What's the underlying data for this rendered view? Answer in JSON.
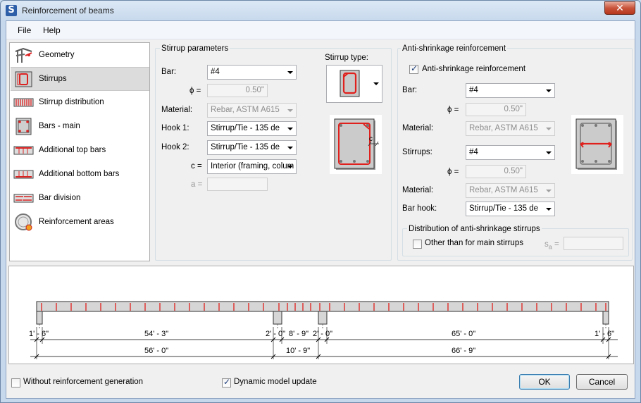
{
  "window": {
    "title": "Reinforcement of beams",
    "app_icon": "S",
    "close_glyph": "✕"
  },
  "menu": [
    "File",
    "Help"
  ],
  "sidebar": {
    "items": [
      {
        "label": "Geometry",
        "icon": "geometry-icon"
      },
      {
        "label": "Stirrups",
        "icon": "stirrups-icon"
      },
      {
        "label": "Stirrup distribution",
        "icon": "stirrup-distribution-icon"
      },
      {
        "label": "Bars - main",
        "icon": "main-bars-icon"
      },
      {
        "label": "Additional top bars",
        "icon": "top-bars-icon"
      },
      {
        "label": "Additional bottom bars",
        "icon": "bottom-bars-icon"
      },
      {
        "label": "Bar division",
        "icon": "bar-division-icon"
      },
      {
        "label": "Reinforcement areas",
        "icon": "reinforcement-areas-icon"
      }
    ],
    "selected": "Stirrups"
  },
  "stirrup_params": {
    "title": "Stirrup parameters",
    "bar_label": "Bar:",
    "bar_value": "#4",
    "phi_label": "ϕ =",
    "phi_value": "0.50\"",
    "material_label": "Material:",
    "material_value": "Rebar, ASTM A615",
    "hook1_label": "Hook 1:",
    "hook1_value": "Stirrup/Tie - 135 de",
    "hook2_label": "Hook 2:",
    "hook2_value": "Stirrup/Tie - 135 de",
    "c_label": "c =",
    "c_value": "Interior (framing, colum",
    "a_label": "a =",
    "a_value": "",
    "stirrup_type_label": "Stirrup type:",
    "preview_c_label": "c"
  },
  "anti_shrinkage": {
    "title": "Anti-shrinkage reinforcement",
    "checkbox_label": "Anti-shrinkage reinforcement",
    "checked": true,
    "bar_label": "Bar:",
    "bar_value": "#4",
    "phi1_label": "ϕ =",
    "phi1_value": "0.50\"",
    "material1_label": "Material:",
    "material1_value": "Rebar, ASTM A615",
    "stirrups_label": "Stirrups:",
    "stirrups_value": "#4",
    "phi2_label": "ϕ =",
    "phi2_value": "0.50\"",
    "material2_label": "Material:",
    "material2_value": "Rebar, ASTM A615",
    "hook_label": "Bar hook:",
    "hook_value": "Stirrup/Tie - 135 de",
    "distribution": {
      "title": "Distribution of anti-shrinkage stirrups",
      "checkbox_label": "Other than for main stirrups",
      "checked": false,
      "sa_label": "s",
      "sa_sub": "a",
      "sa_eq": " =",
      "sa_value": ""
    }
  },
  "beam": {
    "dims_row1": [
      "1' - 6\"",
      "54' - 3\"",
      "2' - 0\"",
      "8' - 9\"",
      "2' - 0\"",
      "65' - 0\"",
      "1' - 6\""
    ],
    "dims_row2": [
      "56' - 0\"",
      "10' - 9\"",
      "66' - 9\""
    ]
  },
  "footer": {
    "no_generation_label": "Without reinforcement generation",
    "no_generation_checked": false,
    "dynamic_update_label": "Dynamic model update",
    "dynamic_update_checked": true,
    "ok_label": "OK",
    "cancel_label": "Cancel"
  },
  "colors": {
    "rebar": "#e0201c",
    "concrete": "#d6d6d6",
    "selected_row": "#dcdcdc",
    "accent": "#3c7fb1"
  }
}
